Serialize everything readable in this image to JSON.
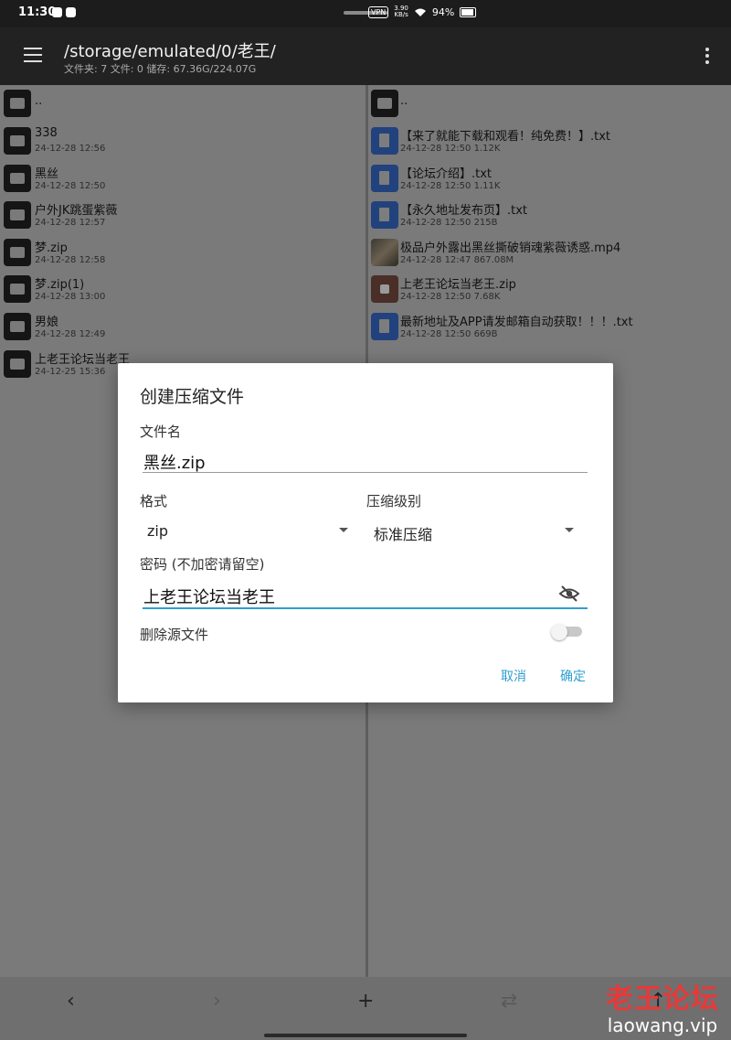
{
  "status_bar": {
    "time": "11:30",
    "vpn": "VPN",
    "speed_value": "3.90",
    "speed_unit": "KB/s",
    "battery": "94%"
  },
  "header": {
    "path": "/storage/emulated/0/老王/",
    "info": "文件夹: 7  文件: 0  储存: 67.36G/224.07G"
  },
  "left_pane": {
    "items": [
      {
        "name": "..",
        "meta": "",
        "icon": "folder-icon"
      },
      {
        "name": "338",
        "meta": "24-12-28 12:56",
        "icon": "folder-icon"
      },
      {
        "name": "黑丝",
        "meta": "24-12-28 12:50",
        "icon": "folder-icon"
      },
      {
        "name": "户外JK跳蛋紫薇",
        "meta": "24-12-28 12:57",
        "icon": "folder-icon"
      },
      {
        "name": "梦.zip",
        "meta": "24-12-28 12:58",
        "icon": "folder-icon"
      },
      {
        "name": "梦.zip(1)",
        "meta": "24-12-28 13:00",
        "icon": "folder-icon"
      },
      {
        "name": "男娘",
        "meta": "24-12-28 12:49",
        "icon": "folder-icon"
      },
      {
        "name": "上老王论坛当老王",
        "meta": "24-12-25 15:36",
        "icon": "folder-icon"
      }
    ]
  },
  "right_pane": {
    "items": [
      {
        "name": "..",
        "meta": "",
        "icon": "folder-icon"
      },
      {
        "name": "【来了就能下载和观看！纯免费！】.txt",
        "meta": "24-12-28 12:50  1.12K",
        "icon": "text-file-icon"
      },
      {
        "name": "【论坛介绍】.txt",
        "meta": "24-12-28 12:50  1.11K",
        "icon": "text-file-icon"
      },
      {
        "name": "【永久地址发布页】.txt",
        "meta": "24-12-28 12:50  215B",
        "icon": "text-file-icon"
      },
      {
        "name": "极品户外露出黑丝撕破销魂紫薇诱惑.mp4",
        "meta": "24-12-28 12:47  867.08M",
        "icon": "video-thumbnail-icon"
      },
      {
        "name": "上老王论坛当老王.zip",
        "meta": "24-12-28 12:50  7.68K",
        "icon": "zip-file-icon"
      },
      {
        "name": "最新地址及APP请发邮箱自动获取！！！.txt",
        "meta": "24-12-28 12:50  669B",
        "icon": "text-file-icon"
      }
    ]
  },
  "dialog": {
    "title": "创建压缩文件",
    "filename_label": "文件名",
    "filename_value": "黑丝.zip",
    "format_label": "格式",
    "format_value": "zip",
    "level_label": "压缩级别",
    "level_value": "标准压缩",
    "password_label": "密码 (不加密请留空)",
    "password_value": "上老王论坛当老王",
    "delete_label": "删除源文件",
    "delete_enabled": false,
    "cancel_label": "取消",
    "ok_label": "确定"
  },
  "bottom_bar": {
    "back": "‹",
    "forward": "›",
    "add": "+",
    "swap": "⇄",
    "up": "↑"
  },
  "watermark": {
    "title": "老王论坛",
    "url": "laowang.vip"
  },
  "colors": {
    "accent": "#2f9fd0",
    "watermark_red": "#e73939",
    "appbar": "#222222"
  }
}
